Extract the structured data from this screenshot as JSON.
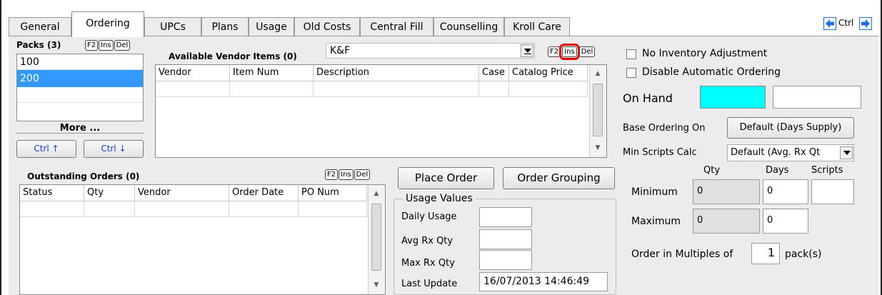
{
  "tabs": [
    "General",
    "Ordering",
    "UPCs",
    "Plans",
    "Usage",
    "Old Costs",
    "Central Fill",
    "Counselling",
    "Kroll Care"
  ],
  "nav": {
    "ctrl_label": "Ctrl"
  },
  "packs": {
    "title": "Packs (3)",
    "keys": [
      "F2",
      "Ins",
      "Del"
    ],
    "items": [
      "100",
      "200"
    ],
    "selected": "200",
    "more_label": "More ...",
    "ctrl_up": "Ctrl ↑",
    "ctrl_down": "Ctrl ↓"
  },
  "vendor_items": {
    "title": "Available Vendor Items (0)",
    "vendor_select": "K&F",
    "keys": [
      "F2",
      "Ins",
      "Del"
    ],
    "columns": [
      "Vendor",
      "Item Num",
      "Description",
      "Case",
      "Catalog Price"
    ]
  },
  "outstanding": {
    "title": "Outstanding Orders (0)",
    "keys": [
      "F2",
      "Ins",
      "Del"
    ],
    "columns": [
      "Status",
      "Qty",
      "Vendor",
      "Order Date",
      "PO Num"
    ]
  },
  "buttons": {
    "place_order": "Place Order",
    "order_grouping": "Order Grouping"
  },
  "usage": {
    "title": "Usage Values",
    "daily_label": "Daily Usage",
    "avg_label": "Avg Rx Qty",
    "max_label": "Max Rx Qty",
    "last_update_label": "Last Update",
    "last_update_value": "16/07/2013 14:46:49"
  },
  "right": {
    "no_inventory_label": "No Inventory Adjustment",
    "disable_auto_label": "Disable Automatic Ordering",
    "on_hand_label": "On Hand",
    "on_hand_color": "#00FFFF",
    "base_ordering_label": "Base Ordering On",
    "base_ordering_value": "Default (Days Supply)",
    "min_scripts_label": "Min Scripts Calc",
    "min_scripts_value": "Default (Avg. Rx Qt",
    "col_qty": "Qty",
    "col_days": "Days",
    "col_scripts": "Scripts",
    "minimum_label": "Minimum",
    "minimum_qty": "0",
    "minimum_days": "0",
    "maximum_label": "Maximum",
    "maximum_qty": "0",
    "maximum_days": "0",
    "order_multiples_label": "Order in Multiples of",
    "order_multiples_value": "1",
    "pack_unit": "pack(s)"
  },
  "colors": {
    "selection": "#3399FF",
    "highlight_border": "#E00000",
    "nav_arrow": "#1E6FD9"
  }
}
